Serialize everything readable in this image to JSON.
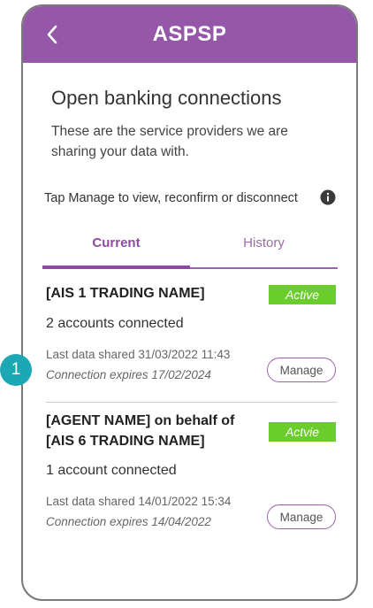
{
  "appbar": {
    "title": "ASPSP",
    "back_icon": "chevron-left-icon",
    "color": "#9557a7"
  },
  "page": {
    "title": "Open banking connections",
    "description": "These are the service providers we are sharing your data with.",
    "tap_hint": "Tap Manage to view, reconfirm or disconnect",
    "info_icon": "info-icon"
  },
  "tabs": [
    {
      "label": "Current",
      "selected": true
    },
    {
      "label": "History",
      "selected": false
    }
  ],
  "connections": [
    {
      "name": "[AIS 1 TRADING NAME]",
      "status": "Active",
      "accounts": "2 accounts connected",
      "last_shared": "Last data shared 31/03/2022 11:43",
      "expires": "Connection expires 17/02/2024",
      "manage_label": "Manage"
    },
    {
      "name_line1": "[AGENT NAME] on behalf of",
      "name_line2": "[AIS 6 TRADING NAME]",
      "status": "Actvie",
      "accounts": "1 account connected",
      "last_shared": "Last data shared 14/01/2022 15:34",
      "expires": "Connection expires 14/04/2022",
      "manage_label": "Manage"
    }
  ],
  "step_marker": "1",
  "colors": {
    "accent": "#8e4aa0",
    "active_badge": "#6bcd2c",
    "marker": "#1ca8b3"
  }
}
